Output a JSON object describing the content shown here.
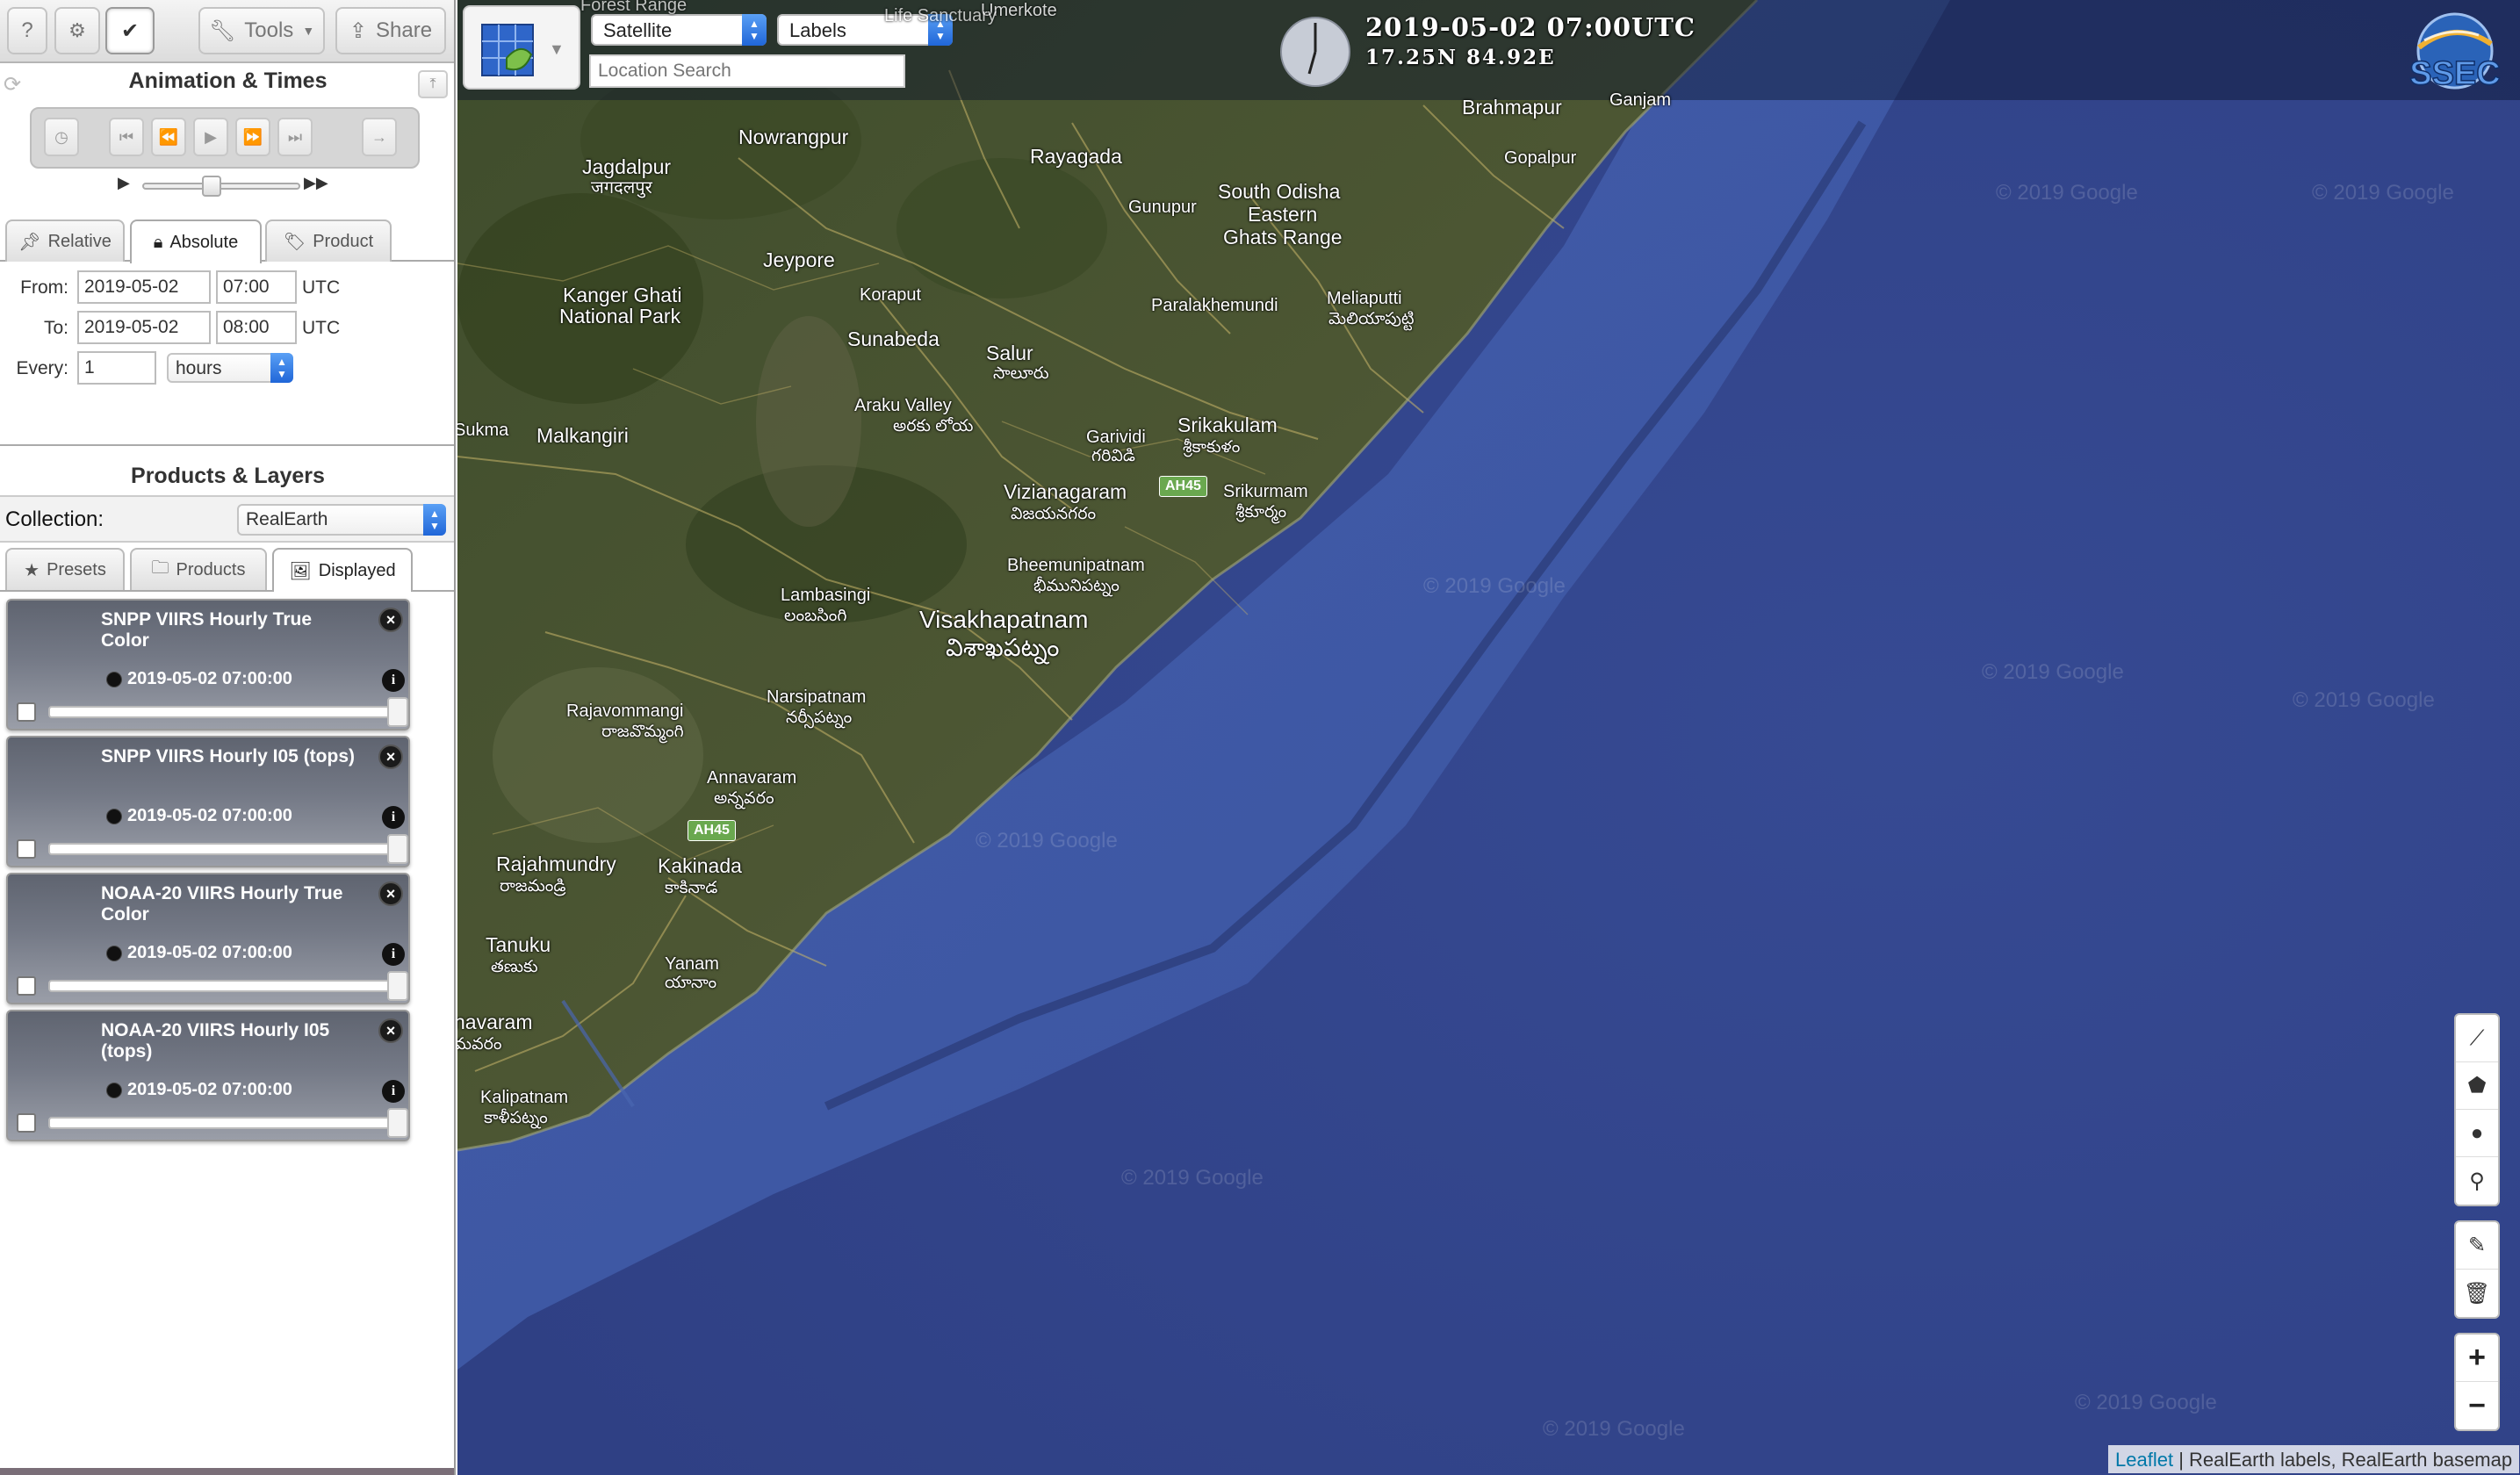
{
  "toolbar": {
    "help_label": "?",
    "settings_icon": "gear-icon",
    "check_icon": "check-icon",
    "tools_label": "Tools",
    "share_label": "Share"
  },
  "animation": {
    "title": "Animation & Times",
    "tabs": [
      {
        "label": "Relative",
        "icon": "pin-icon"
      },
      {
        "label": "Absolute",
        "icon": "lock-icon"
      },
      {
        "label": "Product",
        "icon": "tag-icon"
      }
    ],
    "active_tab": "Absolute",
    "from_label": "From:",
    "from_date": "2019-05-02",
    "from_time": "07:00",
    "to_label": "To:",
    "to_date": "2019-05-02",
    "to_time": "08:00",
    "tz": "UTC",
    "every_label": "Every:",
    "every_value": "1",
    "every_unit": "hours"
  },
  "products": {
    "title": "Products & Layers",
    "collection_label": "Collection:",
    "collection_value": "RealEarth",
    "tabs": [
      {
        "label": "Presets",
        "icon": "star-icon"
      },
      {
        "label": "Products",
        "icon": "folder-icon"
      },
      {
        "label": "Displayed",
        "icon": "image-icon"
      }
    ],
    "active_tab": "Displayed",
    "layers": [
      {
        "title": "SNPP VIIRS Hourly True Color",
        "time": "2019-05-02 07:00:00"
      },
      {
        "title": "SNPP VIIRS Hourly I05 (tops)",
        "time": "2019-05-02 07:00:00"
      },
      {
        "title": "NOAA-20 VIIRS Hourly True Color",
        "time": "2019-05-02 07:00:00"
      },
      {
        "title": "NOAA-20 VIIRS Hourly I05 (tops)",
        "time": "2019-05-02 07:00:00"
      }
    ]
  },
  "map": {
    "basemap_select": "Satellite",
    "labels_select": "Labels",
    "search_placeholder": "Location Search",
    "datetime": "2019-05-02 07:00UTC",
    "coords": "17.25N 84.92E",
    "logo_text": "SSEC",
    "places": {
      "nowrangpur": "Nowrangpur",
      "rayagada": "Rayagada",
      "brahmapur": "Brahmapur",
      "ganjam": "Ganjam",
      "gopalpur": "Gopalpur",
      "jagdalpur": "Jagdalpur",
      "jagdalpur_local": "जगदलपुर",
      "gunupur": "Gunupur",
      "south_odisha": "South Odisha",
      "eastern": "Eastern",
      "ghats_range": "Ghats Range",
      "jeypore": "Jeypore",
      "koraput": "Koraput",
      "kanger_ghati": "Kanger Ghati",
      "national_park": "National Park",
      "paralakhemundi": "Paralakhemundi",
      "meliaputti": "Meliaputti",
      "meliaputti_local": "మెలియాపుట్టి",
      "sunabeda": "Sunabeda",
      "salur": "Salur",
      "salur_local": "సాలూరు",
      "araku_valley": "Araku Valley",
      "araku_local": "అరకు లోయ",
      "sukma": "Sukma",
      "malkangiri": "Malkangiri",
      "garividi": "Garividi",
      "garividi_local": "గరివిడి",
      "srikakulam": "Srikakulam",
      "srikakulam_local": "శ్రీకాకుళం",
      "vizianagaram": "Vizianagaram",
      "vizianagaram_local": "విజయనగరం",
      "srikurmam": "Srikurmam",
      "srikurmam_local": "శ్రీకూర్మం",
      "bheemunipatnam": "Bheemunipatnam",
      "bheemunipatnam_local": "భీమునిపట్నం",
      "lambasingi": "Lambasingi",
      "lambasingi_local": "లంబసింగి",
      "visakhapatnam": "Visakhapatnam",
      "visakhapatnam_local": "విశాఖపట్నం",
      "rajavommangi": "Rajavommangi",
      "rajavommangi_local": "రాజవొమ్మంగి",
      "narsipatnam": "Narsipatnam",
      "narsipatnam_local": "నర్సీపట్నం",
      "annavaram": "Annavaram",
      "annavaram_local": "అన్నవరం",
      "rajahmundry": "Rajahmundry",
      "rajahmundry_local": "రాజమండ్రి",
      "kakinada": "Kakinada",
      "kakinada_local": "కాకినాడ",
      "tanuku": "Tanuku",
      "tanuku_local": "తణుకు",
      "yanam": "Yanam",
      "yanam_local": "యానాం",
      "navaram": "navaram",
      "navaram_local": "మవరం",
      "kalipatnam": "Kalipatnam",
      "kalipatnam_local": "కాళీపట్నం",
      "umerkote": "Umerkote",
      "forest_range": "Forest Range",
      "life_sanctuary": "Life Sanctuary",
      "ah45": "AH45"
    },
    "watermark": "© 2019 Google",
    "attribution_link": "Leaflet",
    "attribution_text": "| RealEarth labels, RealEarth basemap"
  }
}
